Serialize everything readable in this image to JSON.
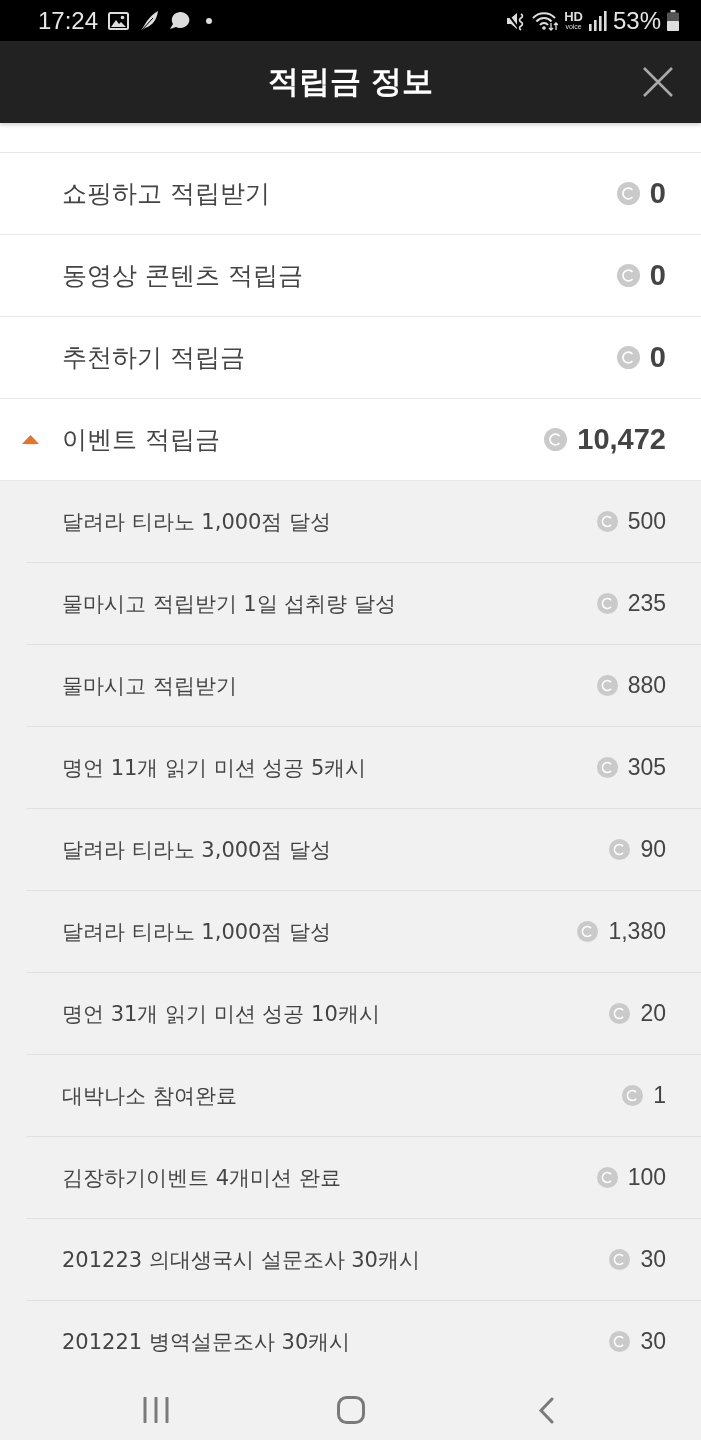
{
  "status_bar": {
    "time": "17:24",
    "hd_label": "HD",
    "voice_label": "voice",
    "battery": "53%"
  },
  "header": {
    "title": "적립금 정보"
  },
  "items": [
    {
      "label": "쇼핑하고 적립받기",
      "amount": "0"
    },
    {
      "label": "동영상 콘텐츠 적립금",
      "amount": "0"
    },
    {
      "label": "추천하기 적립금",
      "amount": "0"
    },
    {
      "label": "이벤트 적립금",
      "amount": "10,472",
      "expanded": true,
      "children": [
        {
          "label": "달려라 티라노 1,000점 달성",
          "amount": "500"
        },
        {
          "label": "물마시고 적립받기 1일 섭취량 달성",
          "amount": "235"
        },
        {
          "label": "물마시고 적립받기",
          "amount": "880"
        },
        {
          "label": "명언 11개 읽기 미션 성공 5캐시",
          "amount": "305"
        },
        {
          "label": "달려라 티라노 3,000점 달성",
          "amount": "90"
        },
        {
          "label": "달려라 티라노 1,000점 달성",
          "amount": "1,380"
        },
        {
          "label": "명언 31개 읽기 미션 성공 10캐시",
          "amount": "20"
        },
        {
          "label": "대박나소 참여완료",
          "amount": "1"
        },
        {
          "label": "김장하기이벤트 4개미션 완료",
          "amount": "100"
        },
        {
          "label": "201223 의대생국시 설문조사 30캐시",
          "amount": "30"
        },
        {
          "label": "201221 병역설문조사 30캐시",
          "amount": "30"
        }
      ]
    }
  ]
}
